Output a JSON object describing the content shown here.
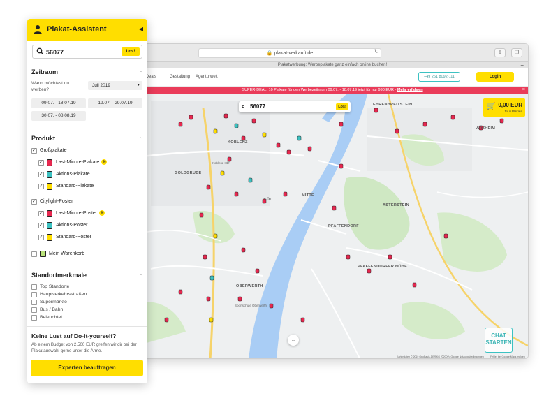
{
  "browser": {
    "url": "plakat-verkauft.de",
    "tab_title": "Plakatwerbung: Werbeplakate ganz einfach online buchen!",
    "nav": [
      "e & Deals",
      "Gestaltung",
      "Agenturwelt"
    ],
    "phone": "+49 261 8092-111",
    "login": "Login",
    "promo_text": "SUPER-DEAL: 10 Plakate für den Werbezeitraum 09.07. - 18.07.19 jetzt für nur 990 EUR -",
    "promo_link": "Mehr erfahren"
  },
  "map": {
    "search_value": "56077",
    "search_button": "Los!",
    "cart_price": "0,00 EUR",
    "cart_count": "für 0 Plakate",
    "chat_line1": "CHAT",
    "chat_line2": "STARTEN",
    "footer_left": "Kartendaten © 2019 GeoBasis-DE/BKG (©2009), Google   Nutzungsbedingungen",
    "footer_right": "Fehler bei Google Maps melden",
    "labels": {
      "goldgrube": "GOLDGRUBE",
      "koblenz": "KOBLENZ",
      "sud": "SÜD",
      "mitte": "MITTE",
      "ehrenbreitstein": "EHRENBREITSTEIN",
      "arzheim": "ARZHEIM",
      "asterstein": "ASTERSTEIN",
      "pfaffendorf": "PFAFFENDORF",
      "pfaffendorfer_hohe": "PFAFFENDORFER HÖHE",
      "oberwerth": "OBERWERTH",
      "hauptbahnhof": "Koblenz Hbf",
      "sportschule": "Sportschule Oberwerth"
    }
  },
  "sidebar": {
    "title": "Plakat-Assistent",
    "search_value": "56077",
    "search_button": "Los!",
    "zeitraum": {
      "title": "Zeitraum",
      "question": "Wann möchtest du werben?",
      "month": "Juli 2019",
      "weeks": [
        "09.07. - 18.07.19",
        "19.07. - 29.07.19",
        "30.07. - 08.08.19"
      ]
    },
    "produkt": {
      "title": "Produkt",
      "grossplakate": "Großplakate",
      "last_minute_plakate": "Last-Minute-Plakate",
      "aktions_plakate": "Aktions-Plakate",
      "standard_plakate": "Standard-Plakate",
      "citylight": "Citylight-Poster",
      "last_minute_poster": "Last-Minute-Poster",
      "aktions_poster": "Aktions-Poster",
      "standard_poster": "Standard-Poster",
      "warenkorb": "Mein Warenkorb",
      "pct": "%"
    },
    "standort": {
      "title": "Standortmerkmale",
      "items": [
        "Top Standorte",
        "Hauptverkehrsstraßen",
        "Supermärkte",
        "Bus / Bahn",
        "Beleuchtet"
      ]
    },
    "diy": {
      "title": "Keine Lust auf Do-it-yourself?",
      "text": "Ab einem Budget von 2.500 EUR greifen wir dir bei der Plakatauswahl gerne unter die Arme.",
      "button": "Experten beauftragen"
    }
  },
  "colors": {
    "brand_yellow": "#ffde00",
    "last_minute_red": "#e8274f",
    "aktion_teal": "#3cc2c2",
    "standard_yellow": "#ffde00",
    "river_blue": "#a9cdf5",
    "cart_green": "#b9e27a"
  }
}
